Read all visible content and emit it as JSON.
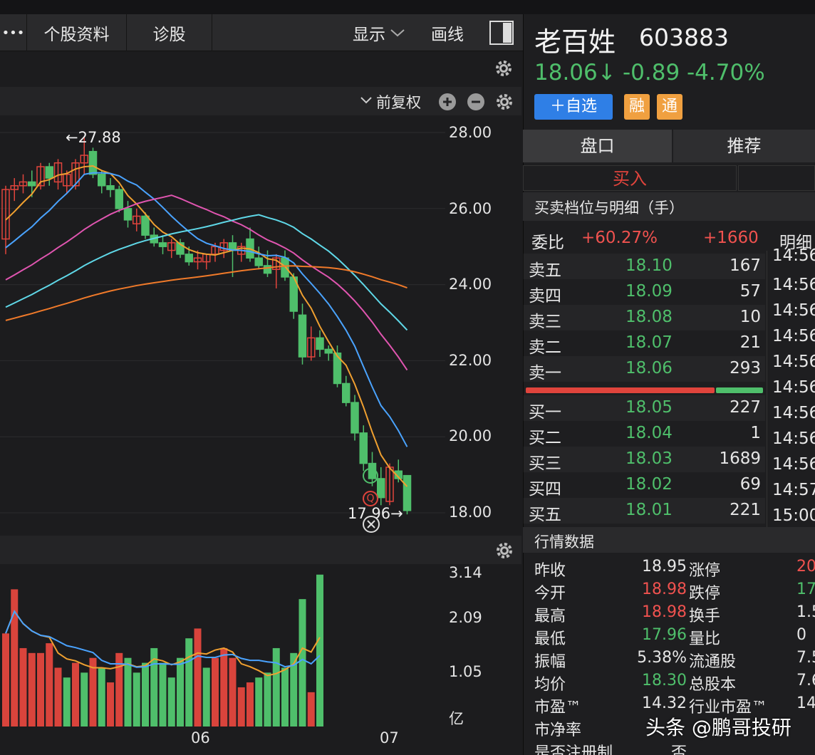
{
  "toolbar": {
    "more": "•••",
    "profile": "个股资料",
    "diagnose": "诊股",
    "display": "显示",
    "draw": "画线"
  },
  "chart": {
    "adjust": "前复权",
    "high_label": "←27.88",
    "low_label": "17.96→",
    "marker_l": "L",
    "marker_q": "Q",
    "price_ticks": [
      "28.00",
      "26.00",
      "24.00",
      "22.00",
      "20.00",
      "18.00"
    ],
    "vol_ticks": [
      "3.14",
      "2.09",
      "1.05"
    ],
    "vol_unit": "亿",
    "x_labels": [
      "06",
      "07"
    ]
  },
  "chart_data": {
    "type": "candlestick",
    "ylim": [
      18,
      28
    ],
    "y_ticks": [
      28,
      26,
      24,
      22,
      20,
      18
    ],
    "annotations": [
      {
        "text": "←27.88",
        "value": 27.88
      },
      {
        "text": "17.96→",
        "value": 17.96
      }
    ],
    "candles": [
      [
        25.2,
        26.6,
        24.8,
        26.5
      ],
      [
        26.5,
        26.8,
        26.2,
        26.6
      ],
      [
        26.6,
        26.9,
        26.4,
        26.7
      ],
      [
        26.7,
        27.0,
        26.3,
        26.6
      ],
      [
        26.6,
        27.2,
        26.5,
        27.1
      ],
      [
        27.1,
        27.2,
        26.6,
        26.8
      ],
      [
        26.7,
        27.3,
        26.5,
        27.2
      ],
      [
        26.6,
        27.0,
        26.4,
        26.9
      ],
      [
        26.6,
        27.3,
        26.5,
        27.2
      ],
      [
        27.2,
        27.9,
        26.9,
        27.4
      ],
      [
        27.5,
        27.6,
        26.8,
        26.9
      ],
      [
        26.9,
        27.0,
        26.4,
        26.6
      ],
      [
        26.6,
        26.8,
        26.3,
        26.5
      ],
      [
        26.5,
        26.6,
        25.9,
        26.0
      ],
      [
        26.0,
        26.2,
        25.5,
        25.7
      ],
      [
        25.6,
        26.0,
        25.4,
        25.8
      ],
      [
        25.8,
        25.9,
        25.2,
        25.3
      ],
      [
        25.3,
        25.5,
        25.0,
        25.1
      ],
      [
        25.1,
        25.3,
        24.8,
        25.0
      ],
      [
        24.9,
        25.2,
        24.7,
        25.1
      ],
      [
        25.1,
        25.2,
        24.7,
        24.8
      ],
      [
        24.8,
        25.0,
        24.5,
        24.6
      ],
      [
        24.6,
        24.9,
        24.4,
        24.7
      ],
      [
        24.6,
        24.8,
        24.4,
        24.8
      ],
      [
        24.8,
        25.1,
        24.6,
        25.0
      ],
      [
        24.9,
        25.2,
        24.7,
        25.1
      ],
      [
        25.1,
        25.3,
        24.2,
        24.9
      ],
      [
        24.8,
        25.1,
        24.6,
        25.0
      ],
      [
        25.2,
        25.5,
        24.6,
        24.7
      ],
      [
        24.7,
        25.0,
        24.4,
        24.5
      ],
      [
        24.5,
        24.9,
        24.2,
        24.3
      ],
      [
        24.4,
        24.8,
        23.9,
        24.7
      ],
      [
        24.7,
        24.9,
        24.1,
        24.2
      ],
      [
        24.2,
        24.3,
        23.1,
        23.3
      ],
      [
        23.2,
        23.5,
        21.9,
        22.1
      ],
      [
        22.1,
        22.9,
        22.0,
        22.6
      ],
      [
        22.6,
        22.8,
        22.1,
        22.3
      ],
      [
        22.3,
        22.4,
        22.0,
        22.2
      ],
      [
        22.2,
        22.4,
        21.3,
        21.4
      ],
      [
        21.4,
        21.6,
        20.8,
        20.9
      ],
      [
        20.9,
        21.1,
        19.9,
        20.1
      ],
      [
        20.1,
        20.3,
        19.1,
        19.3
      ],
      [
        19.3,
        19.6,
        18.7,
        18.9
      ],
      [
        18.9,
        19.2,
        18.2,
        18.4
      ],
      [
        18.3,
        19.3,
        18.2,
        19.2
      ],
      [
        19.1,
        19.4,
        18.8,
        18.9
      ],
      [
        18.98,
        18.98,
        17.96,
        18.06
      ]
    ],
    "volume_series": [
      {
        "color": "#d9443c",
        "values": [
          1.9,
          2.8,
          1.6,
          1.5,
          1.5,
          1.7,
          1.2,
          1.3,
          1.4,
          0.9,
          1.5,
          2.0,
          1.4,
          1.6,
          1.4,
          0.8,
          0.9,
          0.7
        ]
      },
      {
        "color": "#4fbf6b",
        "values": [
          1.0,
          1.1,
          1.2,
          1.4,
          1.1,
          1.3,
          1.6,
          1.3,
          1.0,
          1.4,
          1.8,
          1.2,
          1.0,
          1.1,
          1.6,
          1.2,
          1.5,
          2.6,
          3.1
        ]
      }
    ]
  },
  "stock": {
    "name": "老百姓",
    "code": "603883",
    "price": "18.06↓",
    "change": "-0.89",
    "pct": "-4.70%",
    "watch": "＋自选",
    "badge1": "融",
    "badge2": "通"
  },
  "tabs": {
    "pankou": "盘口",
    "recommend": "推荐",
    "buy": "买入"
  },
  "orderbook": {
    "title": "买卖档位与明细（手）",
    "weibi_label": "委比",
    "weibi_pct": "+60.27%",
    "weibi_diff": "+1660",
    "detail": "明细",
    "asks": [
      {
        "label": "卖五",
        "price": "18.10",
        "vol": "167"
      },
      {
        "label": "卖四",
        "price": "18.09",
        "vol": "57"
      },
      {
        "label": "卖三",
        "price": "18.08",
        "vol": "10"
      },
      {
        "label": "卖二",
        "price": "18.07",
        "vol": "21"
      },
      {
        "label": "卖一",
        "price": "18.06",
        "vol": "293"
      }
    ],
    "bids": [
      {
        "label": "买一",
        "price": "18.05",
        "vol": "227"
      },
      {
        "label": "买二",
        "price": "18.04",
        "vol": "1"
      },
      {
        "label": "买三",
        "price": "18.03",
        "vol": "1689"
      },
      {
        "label": "买四",
        "price": "18.02",
        "vol": "69"
      },
      {
        "label": "买五",
        "price": "18.01",
        "vol": "221"
      }
    ],
    "times": [
      "14:56",
      "14:56",
      "14:56",
      "14:56",
      "14:56",
      "14:56",
      "14:56",
      "14:56",
      "14:56",
      "14:57",
      "15:00"
    ]
  },
  "market": {
    "title": "行情数据",
    "rows": [
      {
        "l": "昨收",
        "v": "18.95",
        "r": "涨停",
        "rv": "20"
      },
      {
        "l": "今开",
        "v": "18.98",
        "r": "跌停",
        "rv": "17"
      },
      {
        "l": "最高",
        "v": "18.98",
        "r": "换手",
        "rv": "1.5"
      },
      {
        "l": "最低",
        "v": "17.96",
        "r": "量比",
        "rv": "0"
      },
      {
        "l": "振幅",
        "v": "5.38%",
        "r": "流通股",
        "rv": "7.5"
      },
      {
        "l": "均价",
        "v": "18.30",
        "r": "总股本",
        "rv": "7.6"
      },
      {
        "l": "市盈™",
        "v": "14.32",
        "r": "行业市盈™",
        "rv": "14"
      },
      {
        "l": "市净率",
        "v": "",
        "r": "",
        "rv": ""
      },
      {
        "l": "是否注册制",
        "v": "否",
        "r": "",
        "rv": ""
      }
    ]
  },
  "watermark": "头条 @鹏哥投研"
}
